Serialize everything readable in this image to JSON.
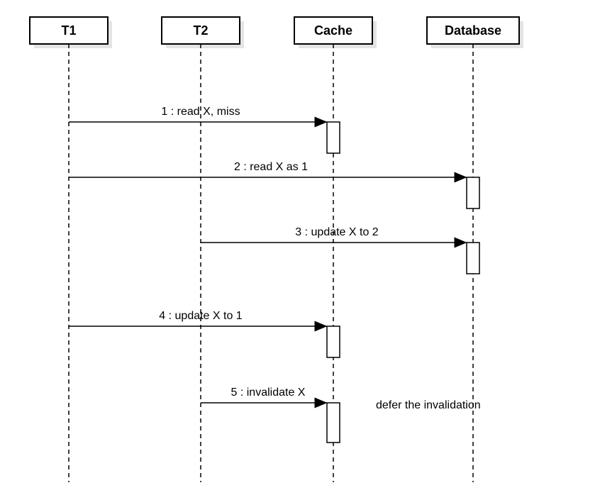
{
  "participants": {
    "p1": "T1",
    "p2": "T2",
    "p3": "Cache",
    "p4": "Database"
  },
  "messages": {
    "m1": "1 : read X, miss",
    "m2": "2 : read X as 1",
    "m3": "3 : update X to 2",
    "m4": "4 : update X to 1",
    "m5": "5 : invalidate X"
  },
  "notes": {
    "n1": "defer the invalidation"
  },
  "chart_data": {
    "type": "sequence-diagram",
    "participants": [
      "T1",
      "T2",
      "Cache",
      "Database"
    ],
    "messages": [
      {
        "seq": 1,
        "from": "T1",
        "to": "Cache",
        "label": "read X, miss"
      },
      {
        "seq": 2,
        "from": "T1",
        "to": "Database",
        "label": "read X as 1"
      },
      {
        "seq": 3,
        "from": "T2",
        "to": "Database",
        "label": "update X to 2"
      },
      {
        "seq": 4,
        "from": "T1",
        "to": "Cache",
        "label": "update X to 1"
      },
      {
        "seq": 5,
        "from": "T2",
        "to": "Cache",
        "label": "invalidate X",
        "note": "defer the invalidation"
      }
    ]
  }
}
